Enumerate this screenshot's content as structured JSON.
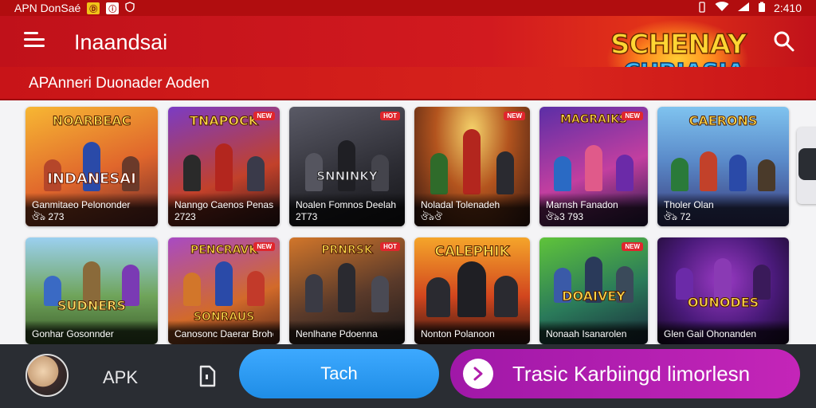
{
  "status_bar": {
    "left_text": "APN DonSaé",
    "badge_1": "Ⓓ",
    "badge_2": "ⓘ",
    "time": "2:410"
  },
  "app_bar": {
    "title": "Inaandsai",
    "logo_line_1": "SCHENAY",
    "logo_line_2": "CURIASIA"
  },
  "sub_bar": {
    "subtitle": "APAnneri Duonader Aoden"
  },
  "row1": [
    {
      "art_title": "NOARBEAC",
      "art_subtitle": "INDANESAI",
      "name": "Ganmitaeo Pelononder",
      "meta": "ঔঌ 273",
      "tag": ""
    },
    {
      "art_title": "TNAPOCK",
      "art_subtitle": "",
      "name": "Nanngo Caenos Penason",
      "meta": "2723",
      "tag": "NEW"
    },
    {
      "art_title": "SNNINKY",
      "art_subtitle": "",
      "name": "Noalen Fomnos Deelah",
      "meta": "2T73",
      "tag": "HOT"
    },
    {
      "art_title": "",
      "art_subtitle": "",
      "name": "Noladal Tolenadeh",
      "meta": "ঔঌঔ",
      "tag": "NEW"
    },
    {
      "art_title": "MAGRAIKS",
      "art_subtitle": "",
      "name": "Marnsh Fanadon",
      "meta": "ঔঌ3 793",
      "tag": "NEW"
    },
    {
      "art_title": "CAERONS",
      "art_subtitle": "",
      "name": "Tholer Olan",
      "meta": "ঔঌ 72",
      "tag": ""
    }
  ],
  "row2": [
    {
      "art_title": "SUDNERS",
      "name": "Gonhar Gosonnder",
      "meta": "",
      "tag": ""
    },
    {
      "art_title": "PENCRAVK",
      "art_subtitle": "SONRAUS",
      "name": "Canosonc Daerar Brohen",
      "meta": "",
      "tag": "NEW"
    },
    {
      "art_title": "PRNRSK",
      "name": "Nenlhane Pdoenna",
      "meta": "",
      "tag": "HOT"
    },
    {
      "art_title": "CALEPHIK",
      "name": "Nonton Polanoon",
      "meta": "",
      "tag": ""
    },
    {
      "art_title": "DOAIVEY",
      "name": "Nonaah Isanarolen",
      "meta": "",
      "tag": "NEW"
    },
    {
      "art_title": "OUNODES",
      "name": "Glen Gail Ohonanden",
      "meta": "",
      "tag": ""
    }
  ],
  "bottom_bar": {
    "apk_label": "APK",
    "primary_button": "Tach",
    "promo_button": "Trasic Karbiingd limorlesn"
  }
}
